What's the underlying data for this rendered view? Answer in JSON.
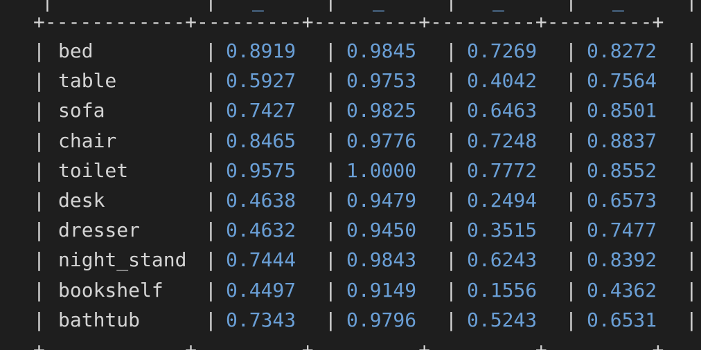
{
  "table": {
    "border_line": "+------------+---------+---------+---------+---------+",
    "rows": [
      {
        "name": "bed",
        "values": [
          "0.8919",
          "0.9845",
          "0.7269",
          "0.8272"
        ]
      },
      {
        "name": "table",
        "values": [
          "0.5927",
          "0.9753",
          "0.4042",
          "0.7564"
        ]
      },
      {
        "name": "sofa",
        "values": [
          "0.7427",
          "0.9825",
          "0.6463",
          "0.8501"
        ]
      },
      {
        "name": "chair",
        "values": [
          "0.8465",
          "0.9776",
          "0.7248",
          "0.8837"
        ]
      },
      {
        "name": "toilet",
        "values": [
          "0.9575",
          "1.0000",
          "0.7772",
          "0.8552"
        ]
      },
      {
        "name": "desk",
        "values": [
          "0.4638",
          "0.9479",
          "0.2494",
          "0.6573"
        ]
      },
      {
        "name": "dresser",
        "values": [
          "0.4632",
          "0.9450",
          "0.3515",
          "0.7477"
        ]
      },
      {
        "name": "night_stand",
        "values": [
          "0.7444",
          "0.9843",
          "0.6243",
          "0.8392"
        ]
      },
      {
        "name": "bookshelf",
        "values": [
          "0.4497",
          "0.9149",
          "0.1556",
          "0.4362"
        ]
      },
      {
        "name": "bathtub",
        "values": [
          "0.7343",
          "0.9796",
          "0.5243",
          "0.6531"
        ]
      }
    ]
  },
  "colors": {
    "background": "#1e1e1e",
    "text": "#d4d4d4",
    "number": "#6a9fd6"
  }
}
